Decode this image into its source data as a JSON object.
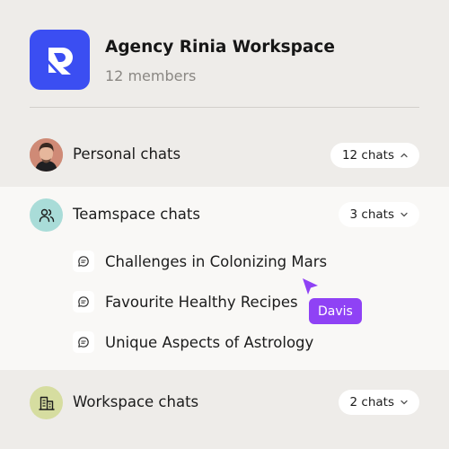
{
  "workspace": {
    "name": "Agency Rinia Workspace",
    "members": "12 members",
    "logo_icon": "rinia-logo",
    "accent": "#3b4ef2"
  },
  "sections": {
    "personal": {
      "label": "Personal chats",
      "count": "12 chats",
      "chevron": "up",
      "avatar": "person-photo"
    },
    "teamspace": {
      "label": "Teamspace chats",
      "count": "3 chats",
      "chevron": "down",
      "icon": "users-icon",
      "icon_bg": "#a9dcd8"
    },
    "workspace": {
      "label": "Workspace chats",
      "count": "2 chats",
      "chevron": "down",
      "icon": "building-icon",
      "icon_bg": "#d6dda0"
    }
  },
  "team_chats": [
    {
      "label": "Challenges in Colonizing Mars",
      "icon": "chat-bubble-icon"
    },
    {
      "label": "Favourite Healthy Recipes",
      "icon": "chat-bubble-icon"
    },
    {
      "label": "Unique Aspects of Astrology",
      "icon": "chat-bubble-icon"
    }
  ],
  "collaborator": {
    "name": "Davis",
    "color": "#8f42f5"
  }
}
